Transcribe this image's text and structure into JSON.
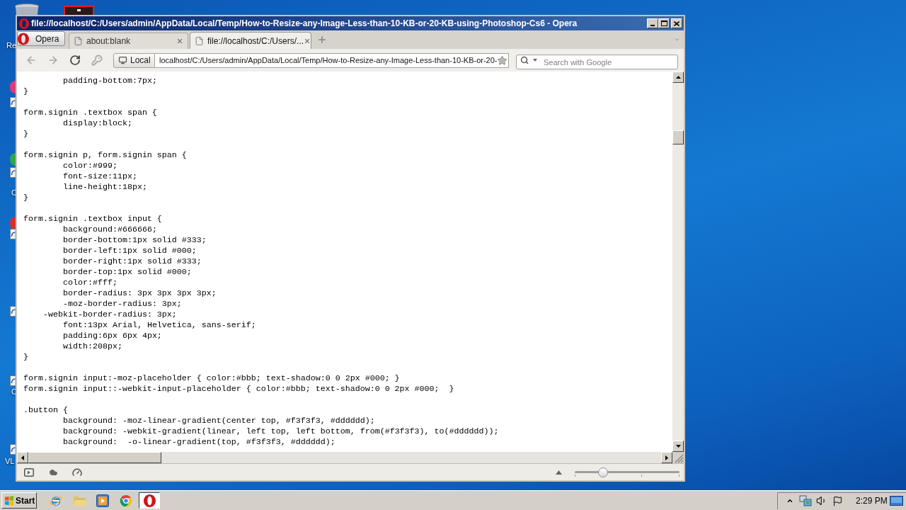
{
  "desktop": {
    "icon_labels": [
      "Re",
      "C",
      "C",
      "VL"
    ]
  },
  "window": {
    "title": "file://localhost/C:/Users/admin/AppData/Local/Temp/How-to-Resize-any-Image-Less-than-10-KB-or-20-KB-using-Photoshop-Cs6 - Opera"
  },
  "menu_button": {
    "label": "Opera"
  },
  "tabs": [
    {
      "label": "about:blank",
      "selected": false
    },
    {
      "label": "file://localhost/C:/Users/...",
      "selected": true
    }
  ],
  "address_bar": {
    "nav_buttons": [
      {
        "kind": "back",
        "disabled": true
      },
      {
        "kind": "forward",
        "disabled": true
      },
      {
        "kind": "reload",
        "disabled": false
      },
      {
        "kind": "key",
        "disabled": true
      }
    ],
    "site_badge": "Local",
    "url": "localhost/C:/Users/admin/AppData/Local/Temp/How-to-Resize-any-Image-Less-than-10-KB-or-20-"
  },
  "search": {
    "placeholder": "Search with Google"
  },
  "code_blocks": [
    [
      "        padding-bottom:7px;",
      "}"
    ],
    [
      "form.signin .textbox span {",
      "        display:block;",
      "}"
    ],
    [
      "form.signin p, form.signin span {",
      "        color:#999;",
      "        font-size:11px;",
      "        line-height:18px;",
      "}"
    ],
    [
      "form.signin .textbox input {",
      "        background:#666666;",
      "        border-bottom:1px solid #333;",
      "        border-left:1px solid #000;",
      "        border-right:1px solid #333;",
      "        border-top:1px solid #000;",
      "        color:#fff;",
      "        border-radius: 3px 3px 3px 3px;",
      "        -moz-border-radius: 3px;",
      "    -webkit-border-radius: 3px;",
      "        font:13px Arial, Helvetica, sans-serif;",
      "        padding:6px 6px 4px;",
      "        width:208px;",
      "}"
    ],
    [
      "form.signin input:-moz-placeholder { color:#bbb; text-shadow:0 0 2px #000; }",
      "form.signin input::-webkit-input-placeholder { color:#bbb; text-shadow:0 0 2px #000;  }"
    ],
    [
      ".button {",
      "        background: -moz-linear-gradient(center top, #f3f3f3, #dddddd);",
      "        background: -webkit-gradient(linear, left top, left bottom, from(#f3f3f3), to(#dddddd));",
      "        background:  -o-linear-gradient(top, #f3f3f3, #dddddd);"
    ]
  ],
  "status_bar": {
    "zoom_slider": {
      "level": 0.27
    }
  },
  "taskbar": {
    "start_label": "Start",
    "apps": [
      {
        "kind": "ie",
        "selected": false
      },
      {
        "kind": "explorer",
        "selected": false
      },
      {
        "kind": "player",
        "selected": false
      },
      {
        "kind": "chrome",
        "selected": false
      },
      {
        "kind": "opera",
        "selected": true
      }
    ],
    "clock": "2:29 PM"
  }
}
